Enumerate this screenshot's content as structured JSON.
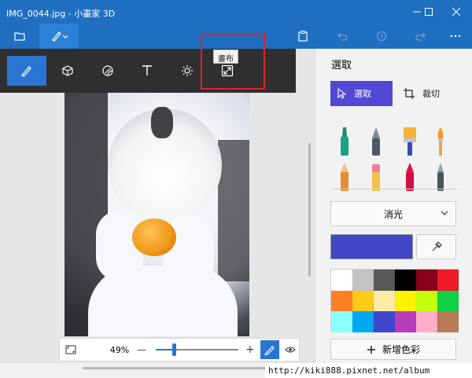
{
  "window": {
    "title": "IMG_0044.jpg - 小畫家 3D",
    "minimize_icon": "minimize-icon",
    "maximize_icon": "maximize-icon",
    "close_icon": "close-icon"
  },
  "appbar": {
    "menu_icon": "folder-icon",
    "brushes_icon": "brush-icon",
    "paste_icon": "paste-icon",
    "undo_icon": "undo-icon",
    "history_icon": "history-icon",
    "redo_icon": "redo-icon",
    "more_icon": "more-icon"
  },
  "toolbar": {
    "tools": [
      {
        "name": "brushes",
        "icon": "brush-icon",
        "selected": true
      },
      {
        "name": "3d-shapes",
        "icon": "cube-icon",
        "selected": false
      },
      {
        "name": "stickers",
        "icon": "sticker-icon",
        "selected": false
      },
      {
        "name": "text",
        "icon": "text-icon",
        "selected": false
      },
      {
        "name": "effects",
        "icon": "sun-icon",
        "selected": false
      },
      {
        "name": "canvas",
        "icon": "resize-icon",
        "selected": false
      }
    ],
    "tooltip": "畫布"
  },
  "bottombar": {
    "zoom_value": "49%",
    "zoom_minus": "—",
    "zoom_plus": "+",
    "zoom_fraction": 0.22
  },
  "sidepanel": {
    "title": "選取",
    "select_label": "選取",
    "crop_label": "裁切",
    "brushes": [
      "marker",
      "calligraphy-pen",
      "oil-brush",
      "watercolor",
      "pencil",
      "eraser",
      "crayon",
      "pixel-pen"
    ],
    "finish_label": "消光",
    "current_color": "#4046c4",
    "palette": [
      "#ffffff",
      "#c3c3c3",
      "#585858",
      "#000000",
      "#88001b",
      "#ec1c24",
      "#ff7f27",
      "#ffca18",
      "#fdeca6",
      "#fff200",
      "#c4ff0e",
      "#0ed145",
      "#8cfffb",
      "#00a8f3",
      "#3f48cc",
      "#b83dba",
      "#ffaec8",
      "#b97a56"
    ],
    "add_color_label": "新增色彩"
  },
  "watermark": "http://kiki888.pixnet.net/album"
}
